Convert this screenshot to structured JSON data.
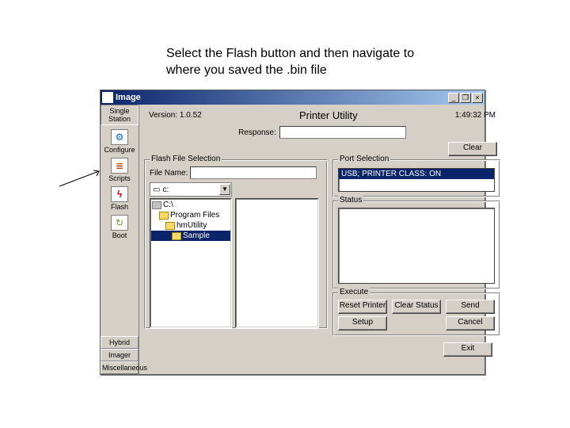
{
  "instruction": "Select the Flash button and then navigate to where you saved the .bin file",
  "window": {
    "title": "Image",
    "min": "_",
    "restore": "❐",
    "close": "×"
  },
  "sidebar": {
    "section_top": "Single Station",
    "items": {
      "configure": "Configure",
      "scripts": "Scripts",
      "flash": "Flash",
      "boot": "Boot"
    },
    "section_bottom": {
      "hybrid": "Hybrid",
      "imager": "Imager",
      "misc": "Miscellaneous"
    }
  },
  "header": {
    "version": "Version: 1.0.52",
    "title": "Printer Utility",
    "time": "1:49:32 PM"
  },
  "response": {
    "label": "Response:",
    "value": ""
  },
  "buttons": {
    "clear": "Clear",
    "reset_printer": "Reset Printer",
    "clear_status": "Clear Status",
    "send": "Send",
    "setup": "Setup",
    "cancel": "Cancel",
    "exit": "Exit"
  },
  "groups": {
    "flash_file": "Flash File Selection",
    "port": "Port Selection",
    "status": "Status",
    "execute": "Execute"
  },
  "file": {
    "name_label": "File Name:",
    "name_value": "",
    "drive_icon": "▭",
    "drive": "c:",
    "folders": {
      "root": "C:\\",
      "program_files": "Program Files",
      "hmutility": "hmUtility",
      "sample": "Sample"
    }
  },
  "port": {
    "selected": "USB; PRINTER CLASS: ON"
  }
}
